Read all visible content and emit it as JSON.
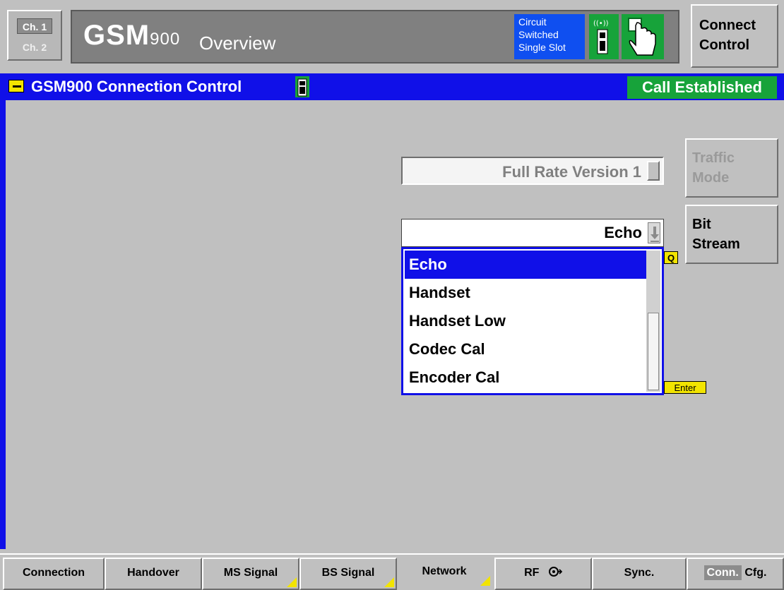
{
  "header": {
    "ch1": "Ch. 1",
    "ch2": "Ch. 2",
    "title_main": "GSM",
    "title_band": "900",
    "title_view": "Overview",
    "circuit_line1": "Circuit",
    "circuit_line2": "Switched",
    "circuit_line3": "Single Slot",
    "connect_line1": "Connect",
    "connect_line2": "Control"
  },
  "banner": {
    "title": "GSM900  Connection Control",
    "status": "Call Established"
  },
  "traffic": {
    "value": "Full Rate Version 1",
    "button_line1": "Traffic",
    "button_line2": "Mode"
  },
  "bitstream": {
    "value": "Echo",
    "button_line1": "Bit",
    "button_line2": "Stream",
    "options": [
      "Echo",
      "Handset",
      "Handset Low",
      "Codec Cal",
      "Encoder Cal"
    ],
    "selected_index": 0
  },
  "tags": {
    "q": "Q",
    "enter": "Enter"
  },
  "tabs": [
    {
      "label": "Connection"
    },
    {
      "label": "Handover"
    },
    {
      "label": "MS Signal"
    },
    {
      "label": "BS Signal"
    },
    {
      "label": "Network"
    },
    {
      "label": "RF"
    },
    {
      "label": "Sync."
    },
    {
      "label": "Conn.",
      "label2": "Cfg."
    }
  ],
  "colors": {
    "banner_blue": "#1010e8",
    "status_green": "#17a33a",
    "softkey_yellow": "#f2e400"
  }
}
